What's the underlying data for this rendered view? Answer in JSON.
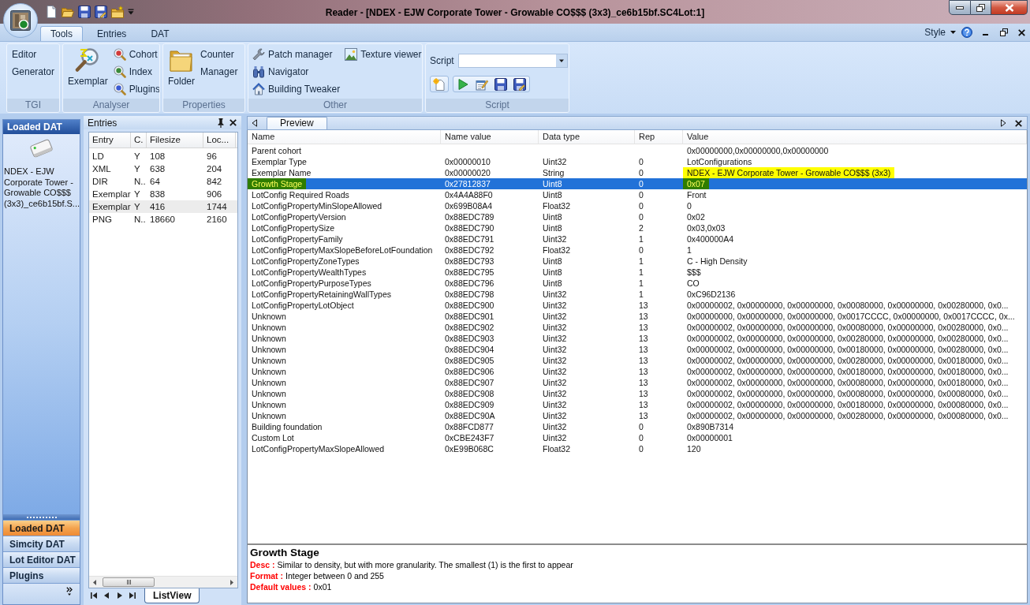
{
  "window": {
    "title": "Reader - [NDEX - EJW Corporate Tower - Growable CO$$$ (3x3)_ce6b15bf.SC4Lot:1]"
  },
  "ribbon": {
    "tabs": [
      {
        "label": "Tools",
        "selected": true
      },
      {
        "label": "Entries",
        "selected": false
      },
      {
        "label": "DAT",
        "selected": false
      }
    ],
    "style_menu": "Style",
    "groups": [
      {
        "label": "TGI",
        "items": [
          {
            "kind": "text",
            "label": "Editor"
          },
          {
            "kind": "text",
            "label": "Generator"
          }
        ]
      },
      {
        "label": "Analyser",
        "items": [
          {
            "kind": "large",
            "label": "Exemplar"
          },
          {
            "kind": "small",
            "label": "Cohort"
          },
          {
            "kind": "small",
            "label": "Index"
          },
          {
            "kind": "small",
            "label": "Plugins"
          }
        ]
      },
      {
        "label": "Properties",
        "items": [
          {
            "kind": "large",
            "label": "Folder"
          },
          {
            "kind": "wrapped",
            "label": "Counter Manager"
          }
        ]
      },
      {
        "label": "Other",
        "items": [
          {
            "kind": "small",
            "label": "Patch manager"
          },
          {
            "kind": "small",
            "label": "Navigator"
          },
          {
            "kind": "small",
            "label": "Building Tweaker"
          },
          {
            "kind": "small",
            "label": "Texture viewer"
          }
        ]
      },
      {
        "label": "Script",
        "items": [
          {
            "kind": "combo",
            "label": "Script"
          },
          {
            "kind": "icon_bar"
          }
        ]
      }
    ]
  },
  "nav_pane": {
    "header": "Loaded DAT",
    "files": [
      {
        "name": "NDEX - EJW Corporate Tower - Growable CO$$$ (3x3)_ce6b15bf.S..."
      }
    ],
    "buttons": [
      {
        "label": "Loaded DAT",
        "selected": true
      },
      {
        "label": "Simcity DAT",
        "selected": false
      },
      {
        "label": "Lot Editor DAT",
        "selected": false
      },
      {
        "label": "Plugins",
        "selected": false
      }
    ]
  },
  "entries": {
    "title": "Entries",
    "columns": [
      "Entry",
      "C.",
      "Filesize",
      "Loc..."
    ],
    "rows": [
      {
        "cells": [
          "LD",
          "Y",
          "108",
          "96"
        ],
        "selected": false
      },
      {
        "cells": [
          "XML",
          "Y",
          "638",
          "204"
        ],
        "selected": false
      },
      {
        "cells": [
          "DIR",
          "N..",
          "64",
          "842"
        ],
        "selected": false
      },
      {
        "cells": [
          "Exemplar",
          "Y",
          "838",
          "906"
        ],
        "selected": false
      },
      {
        "cells": [
          "Exemplar",
          "Y",
          "416",
          "1744"
        ],
        "selected": true
      },
      {
        "cells": [
          "PNG",
          "N..",
          "18660",
          "2160"
        ],
        "selected": false
      }
    ],
    "tabs": [
      {
        "label": "ListView",
        "selected": true
      }
    ]
  },
  "preview": {
    "tabs": [
      {
        "label": "Preview",
        "selected": true
      }
    ],
    "table": {
      "columns": [
        "Name",
        "Name value",
        "Data type",
        "Rep",
        "Value"
      ],
      "rows": [
        {
          "name": "Parent cohort",
          "value": "0x00000000,0x00000000,0x00000000",
          "selected": false,
          "name_marked": false,
          "value_marked": false
        },
        {
          "name": "Exemplar Type",
          "name_value": "0x00000010",
          "data_type": "Uint32",
          "rep": "0",
          "value": "LotConfigurations",
          "selected": false,
          "name_marked": false,
          "value_marked": false
        },
        {
          "name": "Exemplar Name",
          "name_value": "0x00000020",
          "data_type": "String",
          "rep": "0",
          "value": "NDEX - EJW Corporate Tower - Growable CO$$$ (3x3)",
          "selected": false,
          "name_marked": false,
          "value_marked": true
        },
        {
          "name": "Growth Stage",
          "name_value": "0x27812837",
          "data_type": "Uint8",
          "rep": "0",
          "value": "0x07",
          "selected": true,
          "name_marked": true,
          "value_marked": true
        },
        {
          "name": "LotConfig Required Roads",
          "name_value": "0x4A4A88F0",
          "data_type": "Uint8",
          "rep": "0",
          "value": "Front",
          "selected": false,
          "name_marked": false,
          "value_marked": false
        },
        {
          "name": "LotConfigPropertyMinSlopeAllowed",
          "name_value": "0x699B08A4",
          "data_type": "Float32",
          "rep": "0",
          "value": "0",
          "selected": false,
          "name_marked": false,
          "value_marked": false
        },
        {
          "name": "LotConfigPropertyVersion",
          "name_value": "0x88EDC789",
          "data_type": "Uint8",
          "rep": "0",
          "value": "0x02",
          "selected": false,
          "name_marked": false,
          "value_marked": false
        },
        {
          "name": "LotConfigPropertySize",
          "name_value": "0x88EDC790",
          "data_type": "Uint8",
          "rep": "2",
          "value": "0x03,0x03",
          "selected": false,
          "name_marked": false,
          "value_marked": false
        },
        {
          "name": "LotConfigPropertyFamily",
          "name_value": "0x88EDC791",
          "data_type": "Uint32",
          "rep": "1",
          "value": "0x400000A4",
          "selected": false,
          "name_marked": false,
          "value_marked": false
        },
        {
          "name": "LotConfigPropertyMaxSlopeBeforeLotFoundation",
          "name_value": "0x88EDC792",
          "data_type": "Float32",
          "rep": "0",
          "value": "1",
          "selected": false,
          "name_marked": false,
          "value_marked": false
        },
        {
          "name": "LotConfigPropertyZoneTypes",
          "name_value": "0x88EDC793",
          "data_type": "Uint8",
          "rep": "1",
          "value": "C - High Density",
          "selected": false,
          "name_marked": false,
          "value_marked": false
        },
        {
          "name": "LotConfigPropertyWealthTypes",
          "name_value": "0x88EDC795",
          "data_type": "Uint8",
          "rep": "1",
          "value": "$$$",
          "selected": false,
          "name_marked": false,
          "value_marked": false
        },
        {
          "name": "LotConfigPropertyPurposeTypes",
          "name_value": "0x88EDC796",
          "data_type": "Uint8",
          "rep": "1",
          "value": "CO",
          "selected": false,
          "name_marked": false,
          "value_marked": false
        },
        {
          "name": "LotConfigPropertyRetainingWallTypes",
          "name_value": "0x88EDC798",
          "data_type": "Uint32",
          "rep": "1",
          "value": "0xC96D2136",
          "selected": false,
          "name_marked": false,
          "value_marked": false
        },
        {
          "name": "LotConfigPropertyLotObject",
          "name_value": "0x88EDC900",
          "data_type": "Uint32",
          "rep": "13",
          "value": "0x00000002, 0x00000000, 0x00000000, 0x00080000, 0x00000000, 0x00280000, 0x0...",
          "selected": false,
          "name_marked": false,
          "value_marked": false
        },
        {
          "name": "Unknown",
          "name_value": "0x88EDC901",
          "data_type": "Uint32",
          "rep": "13",
          "value": "0x00000000, 0x00000000, 0x00000000, 0x0017CCCC, 0x00000000, 0x0017CCCC, 0x...",
          "selected": false,
          "name_marked": false,
          "value_marked": false
        },
        {
          "name": "Unknown",
          "name_value": "0x88EDC902",
          "data_type": "Uint32",
          "rep": "13",
          "value": "0x00000002, 0x00000000, 0x00000000, 0x00080000, 0x00000000, 0x00280000, 0x0...",
          "selected": false,
          "name_marked": false,
          "value_marked": false
        },
        {
          "name": "Unknown",
          "name_value": "0x88EDC903",
          "data_type": "Uint32",
          "rep": "13",
          "value": "0x00000002, 0x00000000, 0x00000000, 0x00280000, 0x00000000, 0x00280000, 0x0...",
          "selected": false,
          "name_marked": false,
          "value_marked": false
        },
        {
          "name": "Unknown",
          "name_value": "0x88EDC904",
          "data_type": "Uint32",
          "rep": "13",
          "value": "0x00000002, 0x00000000, 0x00000000, 0x00180000, 0x00000000, 0x00280000, 0x0...",
          "selected": false,
          "name_marked": false,
          "value_marked": false
        },
        {
          "name": "Unknown",
          "name_value": "0x88EDC905",
          "data_type": "Uint32",
          "rep": "13",
          "value": "0x00000002, 0x00000000, 0x00000000, 0x00280000, 0x00000000, 0x00180000, 0x0...",
          "selected": false,
          "name_marked": false,
          "value_marked": false
        },
        {
          "name": "Unknown",
          "name_value": "0x88EDC906",
          "data_type": "Uint32",
          "rep": "13",
          "value": "0x00000002, 0x00000000, 0x00000000, 0x00180000, 0x00000000, 0x00180000, 0x0...",
          "selected": false,
          "name_marked": false,
          "value_marked": false
        },
        {
          "name": "Unknown",
          "name_value": "0x88EDC907",
          "data_type": "Uint32",
          "rep": "13",
          "value": "0x00000002, 0x00000000, 0x00000000, 0x00080000, 0x00000000, 0x00180000, 0x0...",
          "selected": false,
          "name_marked": false,
          "value_marked": false
        },
        {
          "name": "Unknown",
          "name_value": "0x88EDC908",
          "data_type": "Uint32",
          "rep": "13",
          "value": "0x00000002, 0x00000000, 0x00000000, 0x00080000, 0x00000000, 0x00080000, 0x0...",
          "selected": false,
          "name_marked": false,
          "value_marked": false
        },
        {
          "name": "Unknown",
          "name_value": "0x88EDC909",
          "data_type": "Uint32",
          "rep": "13",
          "value": "0x00000002, 0x00000000, 0x00000000, 0x00180000, 0x00000000, 0x00080000, 0x0...",
          "selected": false,
          "name_marked": false,
          "value_marked": false
        },
        {
          "name": "Unknown",
          "name_value": "0x88EDC90A",
          "data_type": "Uint32",
          "rep": "13",
          "value": "0x00000002, 0x00000000, 0x00000000, 0x00280000, 0x00000000, 0x00080000, 0x0...",
          "selected": false,
          "name_marked": false,
          "value_marked": false
        },
        {
          "name": "Building foundation",
          "name_value": "0x88FCD877",
          "data_type": "Uint32",
          "rep": "0",
          "value": "0x890B7314",
          "selected": false,
          "name_marked": false,
          "value_marked": false
        },
        {
          "name": "Custom Lot",
          "name_value": "0xCBE243F7",
          "data_type": "Uint32",
          "rep": "0",
          "value": "0x00000001",
          "selected": false,
          "name_marked": false,
          "value_marked": false
        },
        {
          "name": "LotConfigPropertyMaxSlopeAllowed",
          "name_value": "0xE99B068C",
          "data_type": "Float32",
          "rep": "0",
          "value": "120",
          "selected": false,
          "name_marked": false,
          "value_marked": false
        }
      ]
    },
    "detail": {
      "title": "Growth Stage",
      "lines": [
        {
          "label": "Desc :",
          "text": "Similar to density, but with more granularity. The smallest (1) is the first to appear"
        },
        {
          "label": "Format :",
          "text": "Integer between 0 and 255"
        },
        {
          "label": "Default values :",
          "text": "0x01"
        }
      ]
    }
  }
}
